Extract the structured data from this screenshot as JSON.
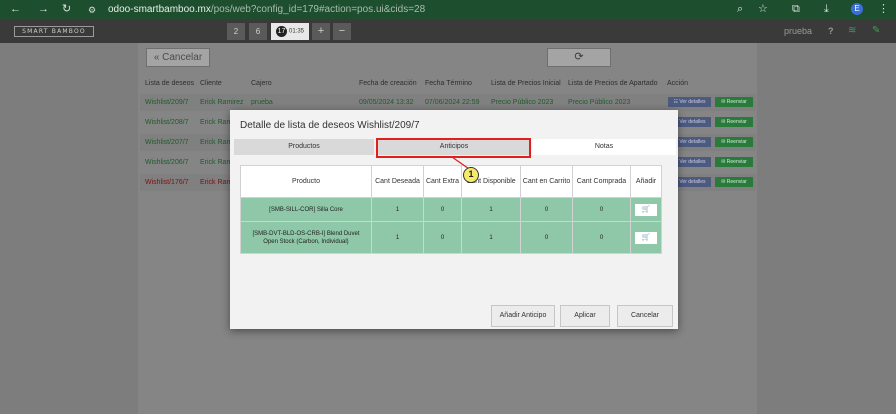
{
  "browser": {
    "url_domain": "odoo-smartbamboo.mx",
    "url_path": "/pos/web?config_id=179#action=pos.ui&cids=28",
    "avatar_letter": "E"
  },
  "pos": {
    "logo_text": "SMART BAMBOO",
    "order_tabs": [
      {
        "label": "2"
      },
      {
        "label": "6"
      },
      {
        "number": "17",
        "time": "01:35"
      }
    ],
    "add_label": "+",
    "remove_label": "−",
    "user": "prueba",
    "help_label": "?"
  },
  "screen": {
    "back_label": "« Cancelar",
    "reload_icon": "⟳",
    "list_headers": [
      "Lista de deseos",
      "Cliente",
      "Cajero",
      "Fecha de creación",
      "Fecha Término",
      "Lista de Precios Inicial",
      "Lista de Precios de Apartado",
      "Acción"
    ],
    "rows": [
      {
        "wishlist": "Wishlist/209/7",
        "client": "Erick Ramirez",
        "cashier": "prueba",
        "created": "09/05/2024 13:32",
        "end": "07/06/2024 22:59",
        "pricelist_initial": "Precio Público 2023",
        "pricelist_layaway": "Precio Público 2023"
      },
      {
        "wishlist": "Wishlist/208/7",
        "client": "Erick Ram"
      },
      {
        "wishlist": "Wishlist/207/7",
        "client": "Erick Ram"
      },
      {
        "wishlist": "Wishlist/206/7",
        "client": "Erick Ram"
      },
      {
        "wishlist": "Wishlist/176/7",
        "client": "Erick Ram"
      }
    ],
    "details_label": "☷ Ver detalles",
    "resend_label": "✉ Reenviar"
  },
  "modal": {
    "title": "Detalle de lista de deseos Wishlist/209/7",
    "tabs": [
      "Productos",
      "Anticipos",
      "Notas"
    ],
    "columns": [
      "Producto",
      "Cant Deseada",
      "Cant Extra",
      "Cant Disponible",
      "Cant en Carrito",
      "Cant Comprada",
      "Añadir"
    ],
    "products": [
      {
        "name": "[SMB-SILL-COR] Silla Core",
        "wanted": "1",
        "extra": "0",
        "available": "1",
        "in_cart": "0",
        "bought": "0"
      },
      {
        "name": "[SMB-DVT-BLD-OS-CRB-I] Blend Duvet Open Stock (Carbon, Individual)",
        "wanted": "1",
        "extra": "0",
        "available": "1",
        "in_cart": "0",
        "bought": "0"
      }
    ],
    "add_icon": "🛒",
    "buttons": {
      "add_advance": "Añadir Anticipo",
      "apply": "Aplicar",
      "cancel": "Cancelar"
    }
  },
  "annotation": {
    "step": "1",
    "highlight_color": "#e0201c",
    "callout_color": "#f5ea6a"
  }
}
